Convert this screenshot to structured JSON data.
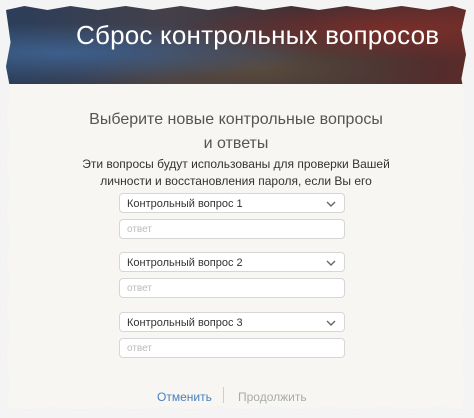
{
  "header": {
    "title": "Сброс контрольных вопросов"
  },
  "form": {
    "subtitle": "Выберите новые контрольные вопросы и ответы",
    "description": "Эти вопросы будут использованы для проверки Вашей личности и восстановления пароля, если Вы его забудете.",
    "questions": [
      {
        "label": "Контрольный вопрос 1",
        "answer_placeholder": "ответ"
      },
      {
        "label": "Контрольный вопрос 2",
        "answer_placeholder": "ответ"
      },
      {
        "label": "Контрольный вопрос 3",
        "answer_placeholder": "ответ"
      }
    ]
  },
  "actions": {
    "cancel_label": "Отменить",
    "continue_label": "Продолжить"
  },
  "colors": {
    "link": "#4b7fb8",
    "disabled": "#aaaaaa"
  }
}
